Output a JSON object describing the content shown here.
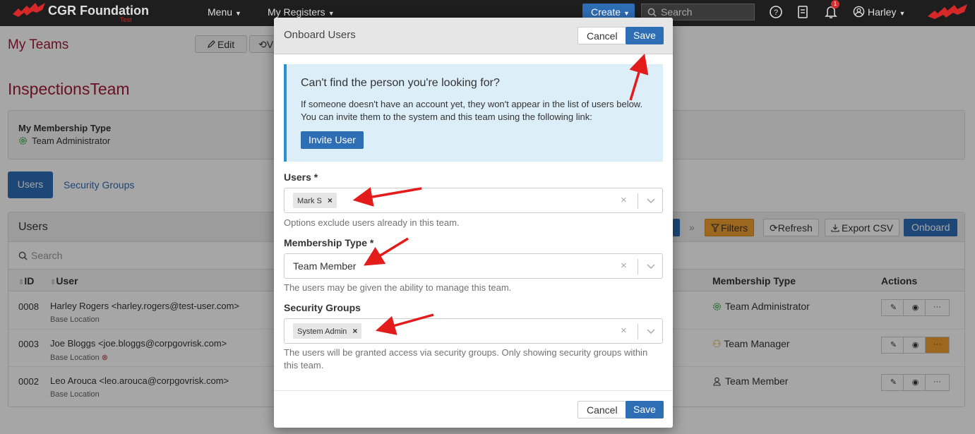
{
  "navbar": {
    "brand": "CGR Foundation",
    "brand_sub": "Test",
    "menu_label": "Menu",
    "registers_label": "My Registers",
    "create_label": "Create",
    "search_placeholder": "Search",
    "notification_count": "1",
    "user_label": "Harley"
  },
  "page": {
    "title": "My Teams",
    "edit_label": "Edit",
    "view_label": "V",
    "team_name": "InspectionsTeam",
    "membership_label": "My Membership Type",
    "membership_value": "Team Administrator"
  },
  "tabs": [
    {
      "label": "Users"
    },
    {
      "label": "Security Groups"
    }
  ],
  "users_panel": {
    "title": "Users",
    "search_placeholder": "Search",
    "filters_label": "Filters",
    "refresh_label": "Refresh",
    "export_label": "Export CSV",
    "onboard_label": "Onboard",
    "columns": {
      "id": "ID",
      "user": "User",
      "membership": "Membership Type",
      "actions": "Actions"
    },
    "rows": [
      {
        "id": "0008",
        "name": "Harley Rogers",
        "email": "<harley.rogers@test-user.com>",
        "location": "Base Location",
        "membership": "Team Administrator",
        "membership_icon": "gear-icon"
      },
      {
        "id": "0003",
        "name": "Joe Bloggs",
        "email": "<joe.bloggs@corpgovrisk.com>",
        "location": "Base Location",
        "membership": "Team Manager",
        "membership_icon": "user-cog-icon"
      },
      {
        "id": "0002",
        "name": "Leo Arouca",
        "email": "<leo.arouca@corpgovrisk.com>",
        "location": "Base Location",
        "membership": "Team Member",
        "membership_icon": "user-icon"
      }
    ]
  },
  "modal": {
    "title": "Onboard Users",
    "cancel_label": "Cancel",
    "save_label": "Save",
    "info_title": "Can't find the person you're looking for?",
    "info_text": "If someone doesn't have an account yet, they won't appear in the list of users below. You can invite them to the system and this team using the following link:",
    "invite_label": "Invite User",
    "users_label": "Users *",
    "users_selected": [
      "Mark S"
    ],
    "users_help": "Options exclude users already in this team.",
    "membership_label": "Membership Type *",
    "membership_value": "Team Member",
    "membership_help": "The users may be given the ability to manage this team.",
    "security_label": "Security Groups",
    "security_selected": [
      "System Admin"
    ],
    "security_help": "The users will be granted access via security groups. Only showing security groups within this team."
  },
  "colors": {
    "accent": "#2d6eb5",
    "brand_red": "#a31740",
    "filters_orange": "#f0a030",
    "annotation_red": "#e31b1b"
  }
}
